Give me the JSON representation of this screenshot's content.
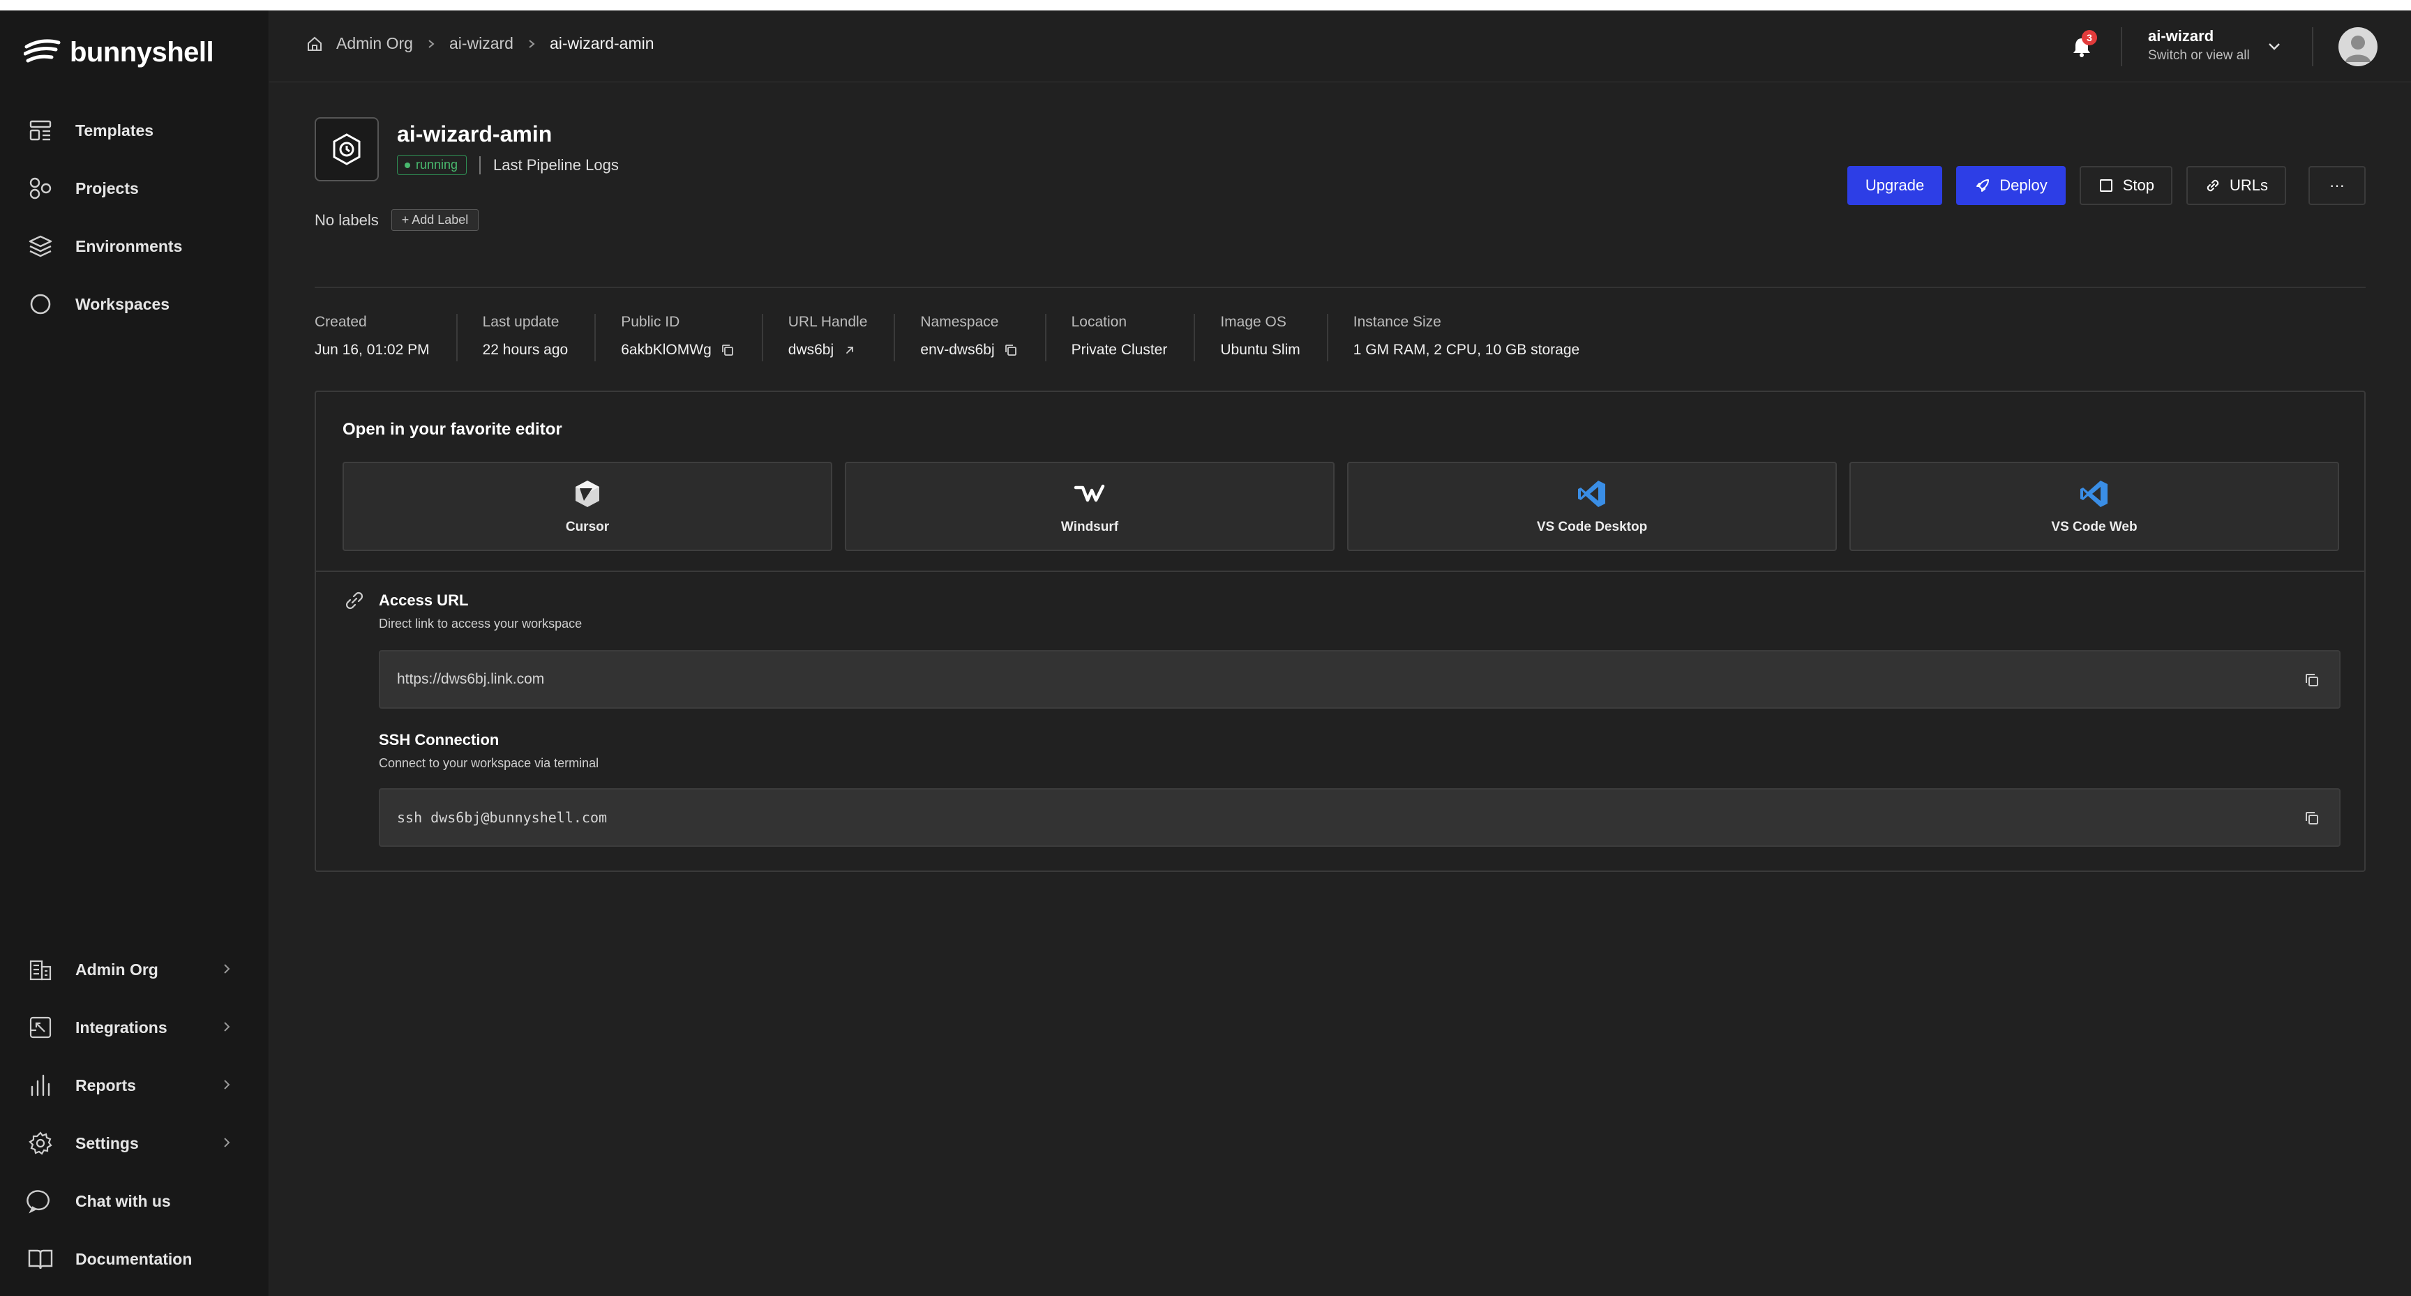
{
  "brand": {
    "name": "bunnyshell"
  },
  "sidebar": {
    "top_items": [
      {
        "label": "Templates",
        "icon": "templates-icon"
      },
      {
        "label": "Projects",
        "icon": "projects-icon"
      },
      {
        "label": "Environments",
        "icon": "environments-icon"
      },
      {
        "label": "Workspaces",
        "icon": "workspaces-icon"
      }
    ],
    "bottom_items": [
      {
        "label": "Admin Org",
        "icon": "building-icon",
        "has_submenu": true
      },
      {
        "label": "Integrations",
        "icon": "integrations-icon",
        "has_submenu": true
      },
      {
        "label": "Reports",
        "icon": "bar-chart-icon",
        "has_submenu": true
      },
      {
        "label": "Settings",
        "icon": "gear-icon",
        "has_submenu": true
      },
      {
        "label": "Chat with us",
        "icon": "chat-icon",
        "has_submenu": false
      },
      {
        "label": "Documentation",
        "icon": "book-icon",
        "has_submenu": false
      }
    ]
  },
  "header": {
    "breadcrumb": [
      "Admin Org",
      "ai-wizard",
      "ai-wizard-amin"
    ],
    "notifications_count": "3",
    "org": {
      "name": "ai-wizard",
      "sub": "Switch or view all"
    }
  },
  "environment": {
    "title": "ai-wizard-amin",
    "status": "running",
    "logs_link": "Last Pipeline Logs",
    "labels_text": "No labels",
    "add_label": "+ Add  Label"
  },
  "actions": {
    "upgrade": "Upgrade",
    "deploy": "Deploy",
    "stop": "Stop",
    "urls": "URLs",
    "more": "···"
  },
  "meta": [
    {
      "key": "Created",
      "value": "Jun 16, 01:02 PM"
    },
    {
      "key": "Last update",
      "value": "22 hours ago"
    },
    {
      "key": "Public ID",
      "value": "6akbKlOMWg"
    },
    {
      "key": "URL Handle",
      "value": "dws6bj"
    },
    {
      "key": "Namespace",
      "value": "env-dws6bj"
    },
    {
      "key": "Location",
      "value": "Private Cluster"
    },
    {
      "key": "Image OS",
      "value": "Ubuntu Slim"
    },
    {
      "key": "Instance Size",
      "value": "1 GM RAM, 2 CPU, 10 GB storage"
    }
  ],
  "editors": {
    "heading": "Open in your favorite editor",
    "items": [
      "Cursor",
      "Windsurf",
      "VS Code Desktop",
      "VS Code Web"
    ]
  },
  "access": {
    "title": "Access URL",
    "subtitle": "Direct link to access your workspace",
    "url": "https://dws6bj.link.com"
  },
  "ssh": {
    "title": "SSH Connection",
    "subtitle": "Connect to your workspace via terminal",
    "command": "ssh dws6bj@bunnyshell.com"
  },
  "colors": {
    "primary": "#2d3ee6",
    "status_running": "#49b86e",
    "badge_red": "#e23b3b",
    "vscode_blue": "#3a8ee6"
  }
}
